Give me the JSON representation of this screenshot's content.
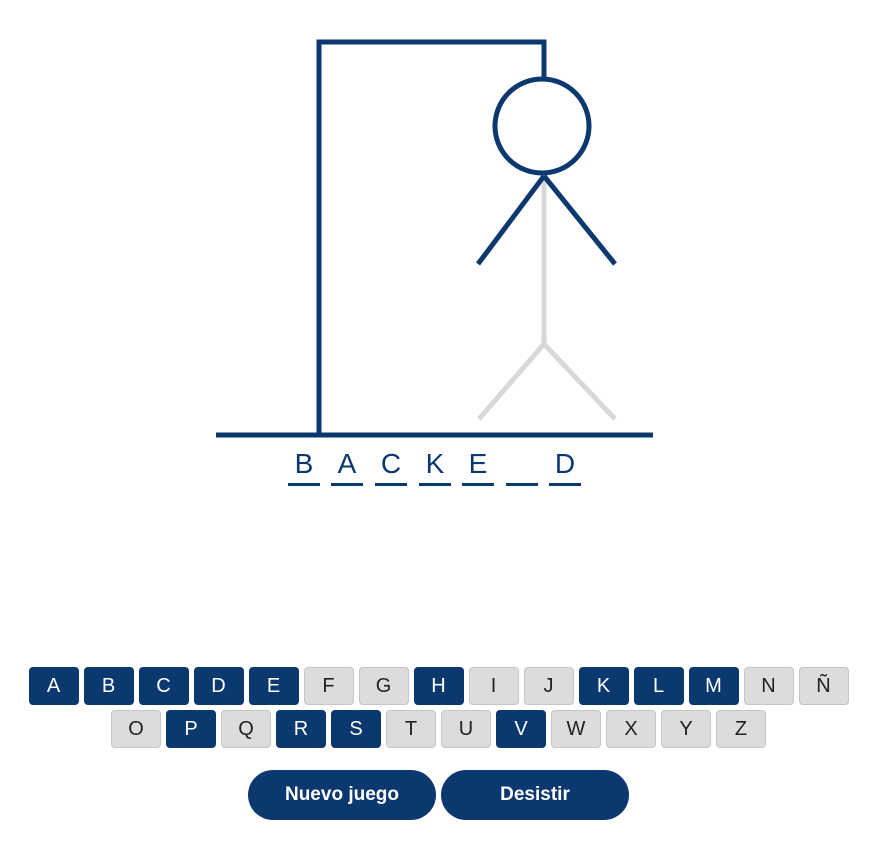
{
  "colors": {
    "primary": "#0b386f",
    "inactive": "#d8d8d8",
    "key_unused_bg": "#dcdcdc"
  },
  "hangman": {
    "drawn_parts": [
      "gallows",
      "rope",
      "head",
      "left-arm",
      "right-arm"
    ],
    "pending_parts": [
      "body",
      "left-leg",
      "right-leg"
    ]
  },
  "word": {
    "slots": [
      "B",
      "A",
      "C",
      "K",
      "E",
      "",
      "D"
    ]
  },
  "keyboard": {
    "rows": [
      [
        {
          "letter": "A",
          "used": true
        },
        {
          "letter": "B",
          "used": true
        },
        {
          "letter": "C",
          "used": true
        },
        {
          "letter": "D",
          "used": true
        },
        {
          "letter": "E",
          "used": true
        },
        {
          "letter": "F",
          "used": false
        },
        {
          "letter": "G",
          "used": false
        },
        {
          "letter": "H",
          "used": true
        },
        {
          "letter": "I",
          "used": false
        },
        {
          "letter": "J",
          "used": false
        },
        {
          "letter": "K",
          "used": true
        },
        {
          "letter": "L",
          "used": true
        },
        {
          "letter": "M",
          "used": true
        },
        {
          "letter": "N",
          "used": false
        },
        {
          "letter": "Ñ",
          "used": false
        }
      ],
      [
        {
          "letter": "O",
          "used": false
        },
        {
          "letter": "P",
          "used": true
        },
        {
          "letter": "Q",
          "used": false
        },
        {
          "letter": "R",
          "used": true
        },
        {
          "letter": "S",
          "used": true
        },
        {
          "letter": "T",
          "used": false
        },
        {
          "letter": "U",
          "used": false
        },
        {
          "letter": "V",
          "used": true
        },
        {
          "letter": "W",
          "used": false
        },
        {
          "letter": "X",
          "used": false
        },
        {
          "letter": "Y",
          "used": false
        },
        {
          "letter": "Z",
          "used": false
        }
      ]
    ]
  },
  "actions": {
    "new_game_label": "Nuevo juego",
    "give_up_label": "Desistir"
  }
}
